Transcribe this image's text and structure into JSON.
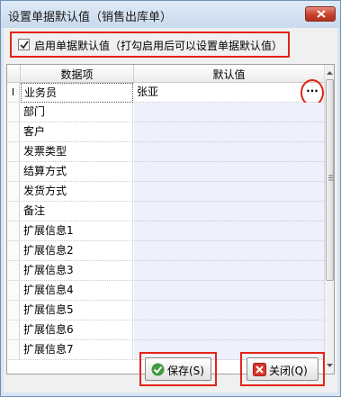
{
  "window": {
    "title": "设置单据默认值（销售出库单）"
  },
  "option": {
    "checked": true,
    "label": "启用单据默认值（打勾启用后可以设置单据默认值）"
  },
  "grid": {
    "columns": [
      "数据项",
      "默认值"
    ],
    "current_row_marker": "I",
    "rows": [
      {
        "item": "业务员",
        "value": "张亚"
      },
      {
        "item": "部门",
        "value": ""
      },
      {
        "item": "客户",
        "value": ""
      },
      {
        "item": "发票类型",
        "value": ""
      },
      {
        "item": "结算方式",
        "value": ""
      },
      {
        "item": "发货方式",
        "value": ""
      },
      {
        "item": "备注",
        "value": ""
      },
      {
        "item": "扩展信息1",
        "value": ""
      },
      {
        "item": "扩展信息2",
        "value": ""
      },
      {
        "item": "扩展信息3",
        "value": ""
      },
      {
        "item": "扩展信息4",
        "value": ""
      },
      {
        "item": "扩展信息5",
        "value": ""
      },
      {
        "item": "扩展信息6",
        "value": ""
      },
      {
        "item": "扩展信息7",
        "value": ""
      }
    ],
    "ellipsis_label": "···"
  },
  "buttons": {
    "save_label": "保存(S)",
    "close_label": "关闭(Q)"
  },
  "colors": {
    "highlight": "#e32418",
    "value_column_bg": "#eef1fb"
  }
}
